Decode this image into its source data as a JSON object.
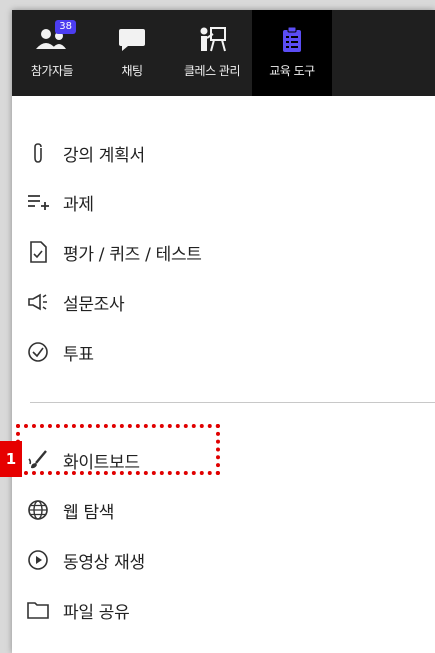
{
  "tabs": [
    {
      "label": "참가자들",
      "icon": "participants-icon",
      "badge": "38"
    },
    {
      "label": "채팅",
      "icon": "chat-icon"
    },
    {
      "label": "클레스 관리",
      "icon": "class-management-icon"
    },
    {
      "label": "교육 도구",
      "icon": "education-tools-icon",
      "active": true
    }
  ],
  "menu": [
    {
      "label": "강의 계획서",
      "icon": "paperclip-icon"
    },
    {
      "label": "과제",
      "icon": "add-list-icon"
    },
    {
      "label": "평가 / 퀴즈 / 테스트",
      "icon": "quiz-document-icon"
    },
    {
      "label": "설문조사",
      "icon": "megaphone-icon"
    },
    {
      "label": "투표",
      "icon": "check-circle-icon"
    },
    {
      "label": "화이트보드",
      "icon": "brush-icon"
    },
    {
      "label": "웹 탐색",
      "icon": "globe-icon"
    },
    {
      "label": "동영상 재생",
      "icon": "play-circle-icon"
    },
    {
      "label": "파일 공유",
      "icon": "folder-icon"
    }
  ],
  "callout": {
    "number": "1"
  },
  "colors": {
    "topbar": "#1f1f1f",
    "active_tab": "#000000",
    "badge": "#4c3df0",
    "highlight": "#e00000"
  }
}
